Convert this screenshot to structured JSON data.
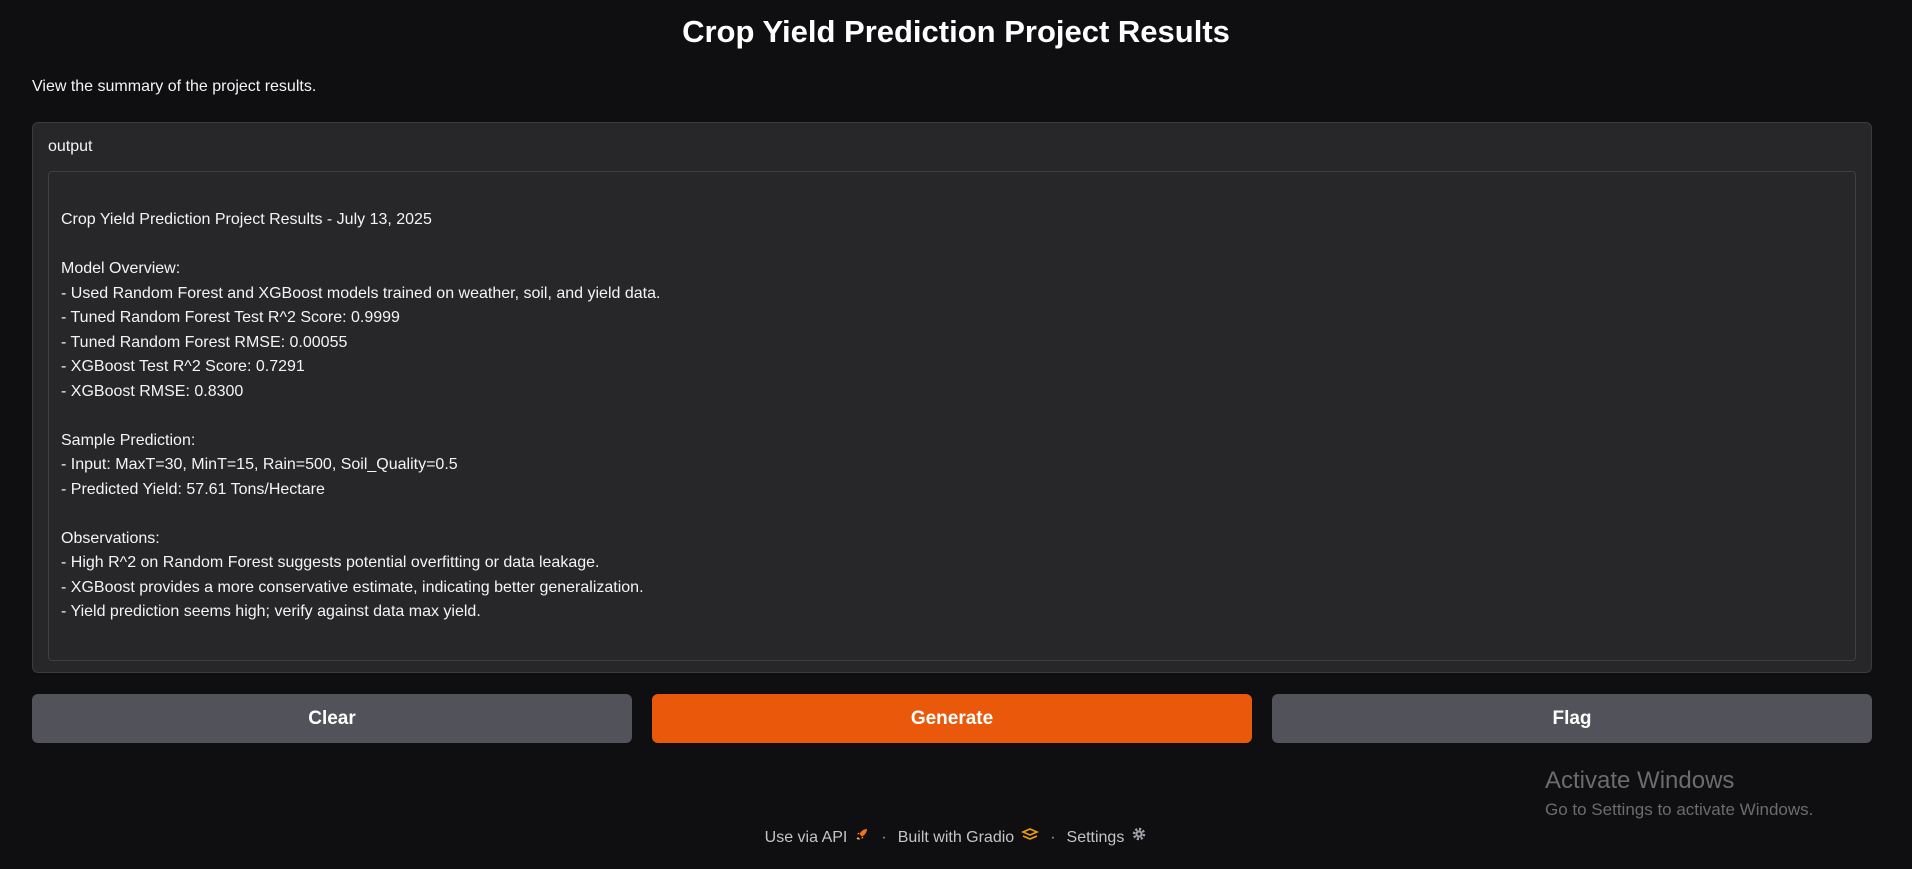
{
  "header": {
    "title": "Crop Yield Prediction Project Results",
    "description": "View the summary of the project results."
  },
  "output": {
    "label": "output",
    "lines": [
      "Crop Yield Prediction Project Results - July 13, 2025",
      "",
      "Model Overview:",
      "- Used Random Forest and XGBoost models trained on weather, soil, and yield data.",
      "- Tuned Random Forest Test R^2 Score: 0.9999",
      "- Tuned Random Forest RMSE: 0.00055",
      "- XGBoost Test R^2 Score: 0.7291",
      "- XGBoost RMSE: 0.8300",
      "",
      "Sample Prediction:",
      "- Input: MaxT=30, MinT=15, Rain=500, Soil_Quality=0.5",
      "- Predicted Yield: 57.61 Tons/Hectare",
      "",
      "Observations:",
      "- High R^2 on Random Forest suggests potential overfitting or data leakage.",
      "- XGBoost provides a more conservative estimate, indicating better generalization.",
      "- Yield prediction seems high; verify against data max yield."
    ]
  },
  "buttons": {
    "clear": "Clear",
    "generate": "Generate",
    "flag": "Flag"
  },
  "footer": {
    "api": "Use via API",
    "separator": "·",
    "built_with": "Built with Gradio",
    "settings": "Settings"
  },
  "watermark": {
    "title": "Activate Windows",
    "subtitle": "Go to Settings to activate Windows."
  },
  "colors": {
    "background": "#0f0f11",
    "panel": "#27272a",
    "primary": "#ea580c",
    "secondary": "#52525b"
  }
}
